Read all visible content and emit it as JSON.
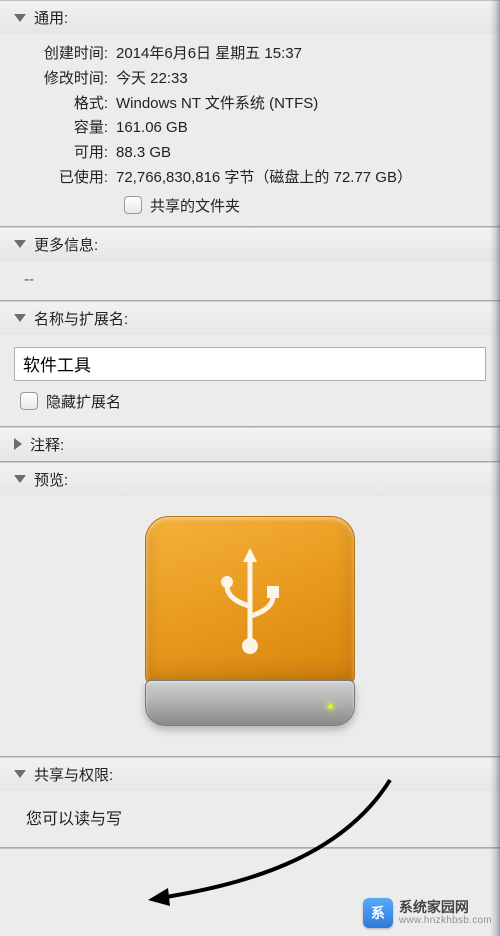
{
  "sections": {
    "general": {
      "title": "通用:",
      "created_label": "创建时间:",
      "created_value": "2014年6月6日 星期五 15:37",
      "modified_label": "修改时间:",
      "modified_value": "今天 22:33",
      "format_label": "格式:",
      "format_value": "Windows NT 文件系统 (NTFS)",
      "capacity_label": "容量:",
      "capacity_value": "161.06 GB",
      "available_label": "可用:",
      "available_value": "88.3 GB",
      "used_label": "已使用:",
      "used_value": "72,766,830,816 字节（磁盘上的 72.77 GB）",
      "shared_folder_label": "共享的文件夹"
    },
    "more_info": {
      "title": "更多信息:",
      "content": "--"
    },
    "name_ext": {
      "title": "名称与扩展名:",
      "name_value": "软件工具",
      "hide_ext_label": "隐藏扩展名"
    },
    "comments": {
      "title": "注释:"
    },
    "preview": {
      "title": "预览:"
    },
    "sharing_perm": {
      "title": "共享与权限:",
      "permission_text": "您可以读与写"
    }
  },
  "watermark": {
    "line1": "系统家园网",
    "line2": "www.hnzkhbsb.com"
  }
}
